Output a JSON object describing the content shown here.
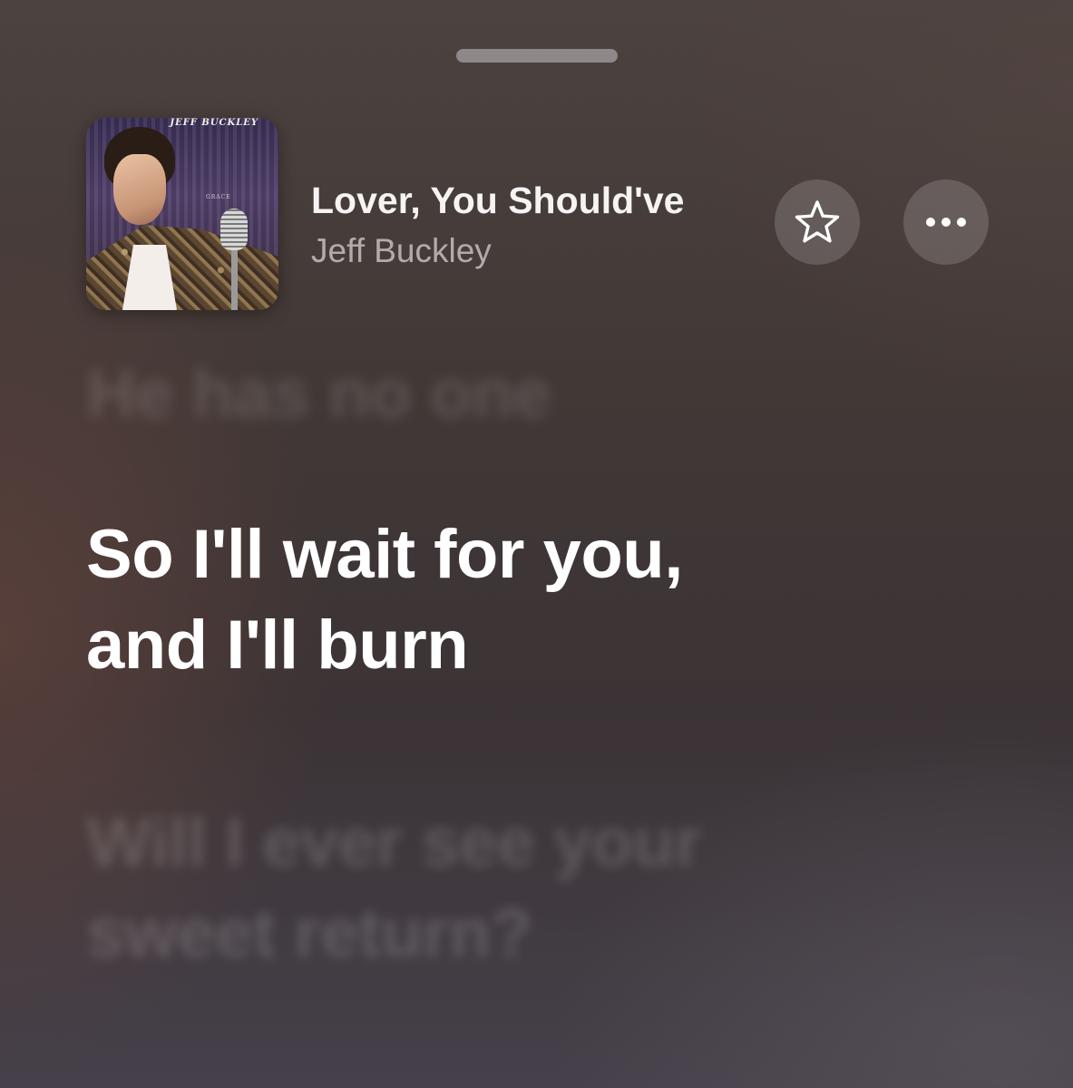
{
  "header": {
    "grabber": "sheet-grabber"
  },
  "now_playing": {
    "album_art": {
      "artist_lettering": "JEFF BUCKLEY",
      "album_lettering": "GRACE"
    },
    "title": "Lover, You Should've",
    "artist": "Jeff Buckley",
    "favorite_icon": "star-icon",
    "more_icon": "ellipsis-icon"
  },
  "lyrics": {
    "previous": [
      "He has no one"
    ],
    "current": [
      "So I'll wait for you,",
      "and I'll burn"
    ],
    "next": [
      "Will I ever see your",
      "sweet return?"
    ]
  },
  "colors": {
    "background": "#433a39",
    "active_lyric": "#ffffff",
    "button_fill": "rgba(255,255,255,0.16)"
  }
}
